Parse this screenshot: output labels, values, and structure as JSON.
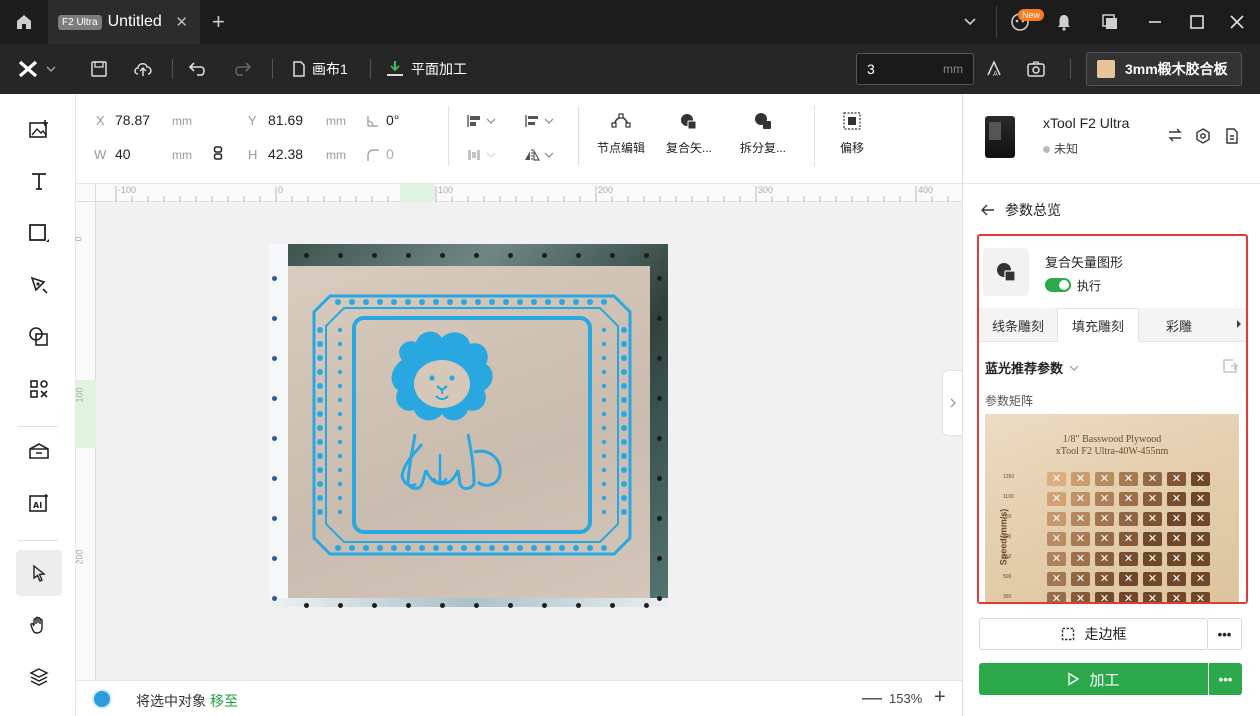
{
  "titlebar": {
    "tab_badge": "F2 Ultra",
    "tab_title": "Untitled",
    "close_glyph": "✕",
    "new_tab_glyph": "+",
    "new_badge": "New",
    "icons": [
      "home-icon",
      "chevron-down-icon",
      "assistant-icon",
      "bell-icon",
      "windows-icon",
      "minimize-icon",
      "maximize-icon",
      "close-icon"
    ]
  },
  "toolbar": {
    "canvas_label": "画布1",
    "process_mode": "平面加工",
    "thickness_value": "3",
    "thickness_unit": "mm",
    "material": "3mm椴木胶合板"
  },
  "properties": {
    "x_label": "X",
    "x_value": "78.87",
    "x_unit": "mm",
    "y_label": "Y",
    "y_value": "81.69",
    "y_unit": "mm",
    "w_label": "W",
    "w_value": "40",
    "w_unit": "mm",
    "h_label": "H",
    "h_value": "42.38",
    "h_unit": "mm",
    "angle_value": "0°",
    "corner_value": "0",
    "actions": {
      "node_edit": "节点编辑",
      "combine": "复合矢...",
      "split": "拆分复...",
      "offset": "偏移"
    }
  },
  "ruler": {
    "top": [
      "-100",
      "0",
      "100",
      "200",
      "300",
      "400"
    ],
    "left": [
      "0",
      "100",
      "200"
    ]
  },
  "status": {
    "text": "将选中对象",
    "link": "移至",
    "zoom_minus": "—",
    "zoom": "153%",
    "zoom_plus": "+"
  },
  "device": {
    "name": "xTool F2 Ultra",
    "status": "未知"
  },
  "panel": {
    "back_label": "参数总览",
    "object_name": "复合矢量图形",
    "execute_label": "执行",
    "tabs": [
      {
        "label": "线条雕刻"
      },
      {
        "label": "填充雕刻"
      },
      {
        "label": "彩雕"
      }
    ],
    "preset_label": "蓝光推荐参数",
    "matrix_label": "参数矩阵",
    "matrix_title_1": "1/8\" Basswood Plywood",
    "matrix_title_2": "xTool F2 Ultra-40W-455nm",
    "matrix_speed_label": "Speed(mm/s)",
    "matrix_rows": [
      "1250",
      "1100",
      "950",
      "800",
      "650",
      "500",
      "350"
    ],
    "frame_button": "走边框",
    "process_button": "加工",
    "more_glyph": "•••"
  },
  "colors": {
    "accent_green": "#2aa84a",
    "highlight_red": "#e53935",
    "design_blue": "#29a7e1"
  }
}
